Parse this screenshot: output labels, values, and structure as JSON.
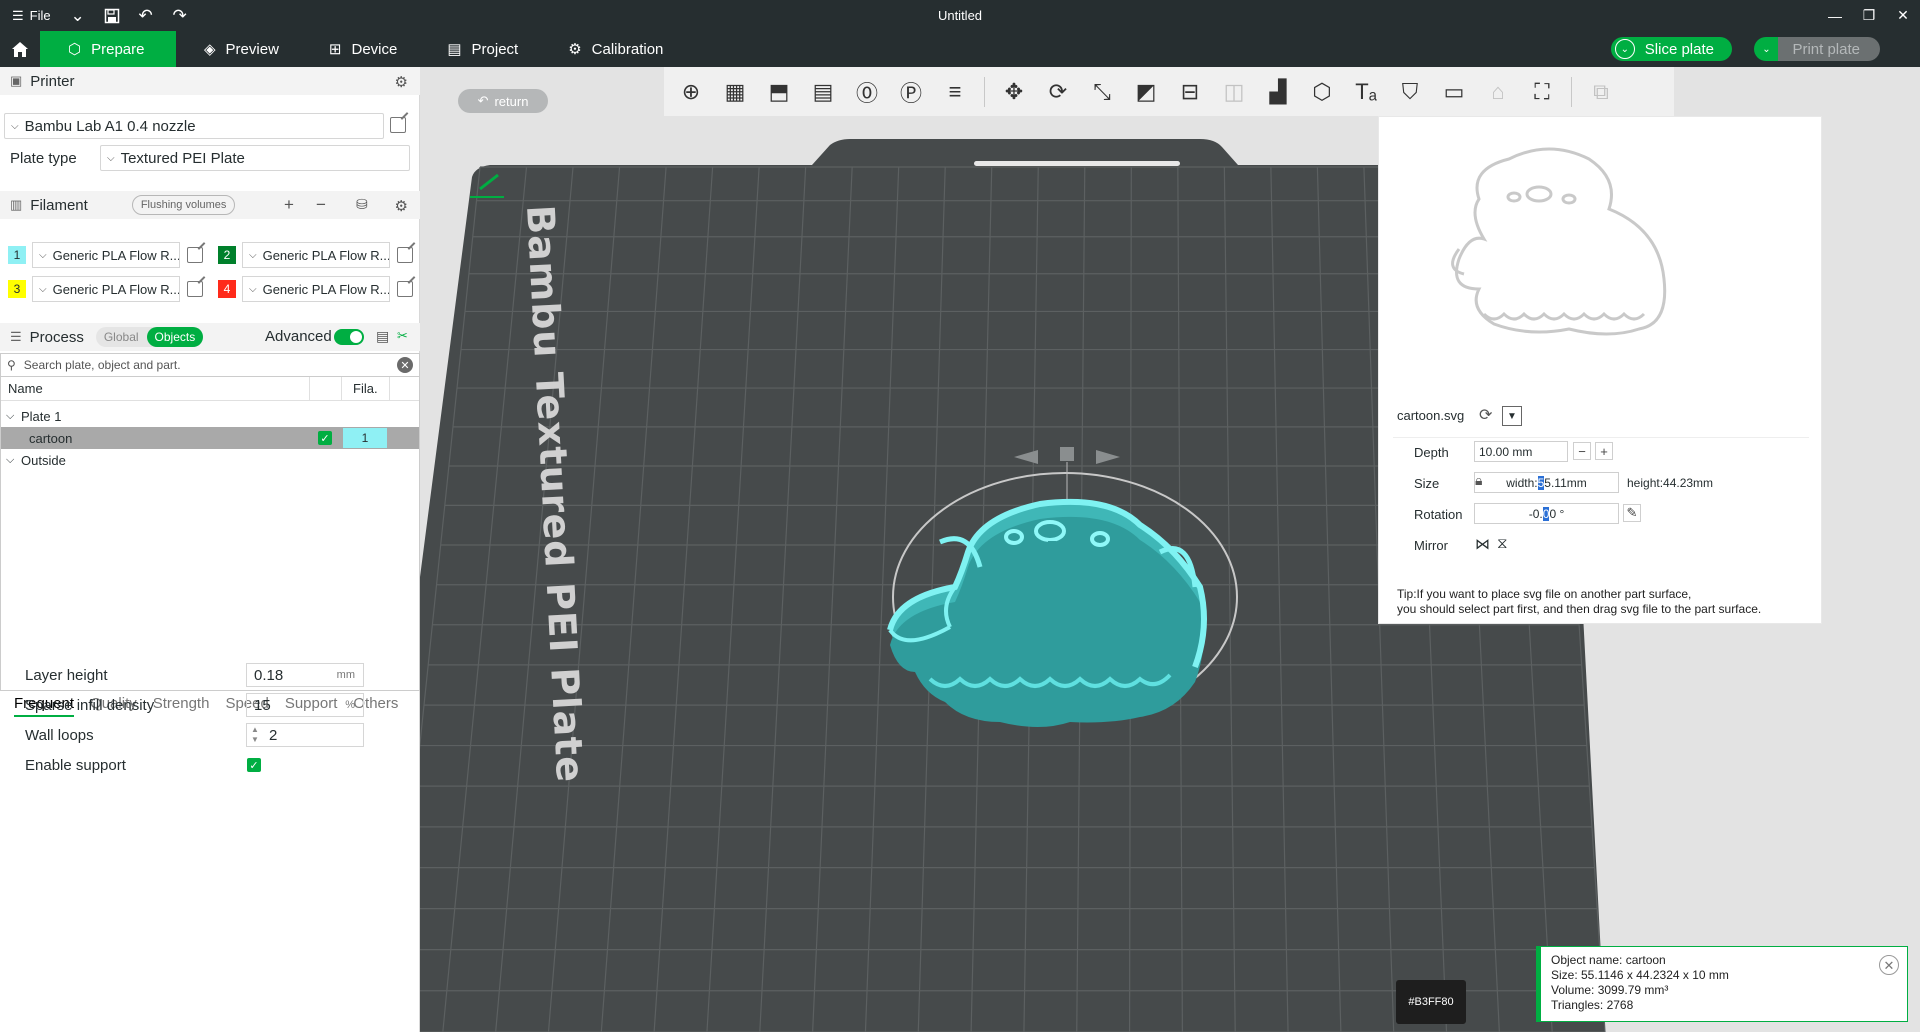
{
  "titlebar": {
    "menu_label": "File",
    "document_title": "Untitled"
  },
  "tabs": [
    {
      "label": "Prepare",
      "icon": "cube-icon"
    },
    {
      "label": "Preview",
      "icon": "layers-icon"
    },
    {
      "label": "Device",
      "icon": "device-icon"
    },
    {
      "label": "Project",
      "icon": "project-icon"
    },
    {
      "label": "Calibration",
      "icon": "calibration-icon"
    }
  ],
  "actions": {
    "slice_label": "Slice plate",
    "print_label": "Print plate"
  },
  "printer": {
    "section_title": "Printer",
    "name": "Bambu Lab A1 0.4 nozzle",
    "plate_type_label": "Plate type",
    "plate_type_value": "Textured PEI Plate"
  },
  "filament": {
    "section_title": "Filament",
    "flush_label": "Flushing volumes",
    "slots": [
      {
        "index": "1",
        "name": "Generic PLA Flow R...",
        "color": "#8ff0f4"
      },
      {
        "index": "2",
        "name": "Generic PLA Flow R...",
        "color": "#00802b"
      },
      {
        "index": "3",
        "name": "Generic PLA Flow R...",
        "color": "#ffff00"
      },
      {
        "index": "4",
        "name": "Generic PLA Flow R...",
        "color": "#ff2a1a"
      }
    ]
  },
  "process": {
    "section_title": "Process",
    "global_label": "Global",
    "objects_label": "Objects",
    "advanced_label": "Advanced",
    "search_placeholder": "Search plate, object and part."
  },
  "object_table": {
    "col_name": "Name",
    "col_fila": "Fila.",
    "plate_label": "Plate 1",
    "object_name": "cartoon",
    "object_fila": "1",
    "outside_label": "Outside"
  },
  "param_tabs": [
    "Frequent",
    "Quality",
    "Strength",
    "Speed",
    "Support",
    "Others"
  ],
  "params": {
    "layer_height_label": "Layer height",
    "layer_height_value": "0.18",
    "layer_height_unit": "mm",
    "infill_label": "Sparse infill density",
    "infill_value": "15",
    "infill_unit": "%",
    "wall_label": "Wall loops",
    "wall_value": "2",
    "support_label": "Enable support"
  },
  "viewport": {
    "return_label": "return",
    "plate_text": "Bambu Textured PEI Plate"
  },
  "svg_panel": {
    "file_name": "cartoon.svg",
    "depth_label": "Depth",
    "depth_value": "10.00 mm",
    "size_label": "Size",
    "width_prefix": "width:",
    "width_sel": "5",
    "width_rest": "5.11mm",
    "height_text": "height:44.23mm",
    "rotation_label": "Rotation",
    "rotation_pre": "-0.",
    "rotation_sel": "0",
    "rotation_post": "0 °",
    "mirror_label": "Mirror",
    "tip_line1": "Tip:If you want to place svg file on another part surface,",
    "tip_line2": "you should select part first, and then drag svg file to the part surface."
  },
  "color_chip": "#B3FF80",
  "info": {
    "name": "Object name: cartoon",
    "size": "Size: 55.1146 x 44.2324 x 10 mm",
    "volume": "Volume: 3099.79 mm³",
    "triangles": "Triangles: 2768"
  },
  "colors": {
    "accent": "#00ae42",
    "dark_bar": "#262e30",
    "model": "#4fd9d9"
  }
}
